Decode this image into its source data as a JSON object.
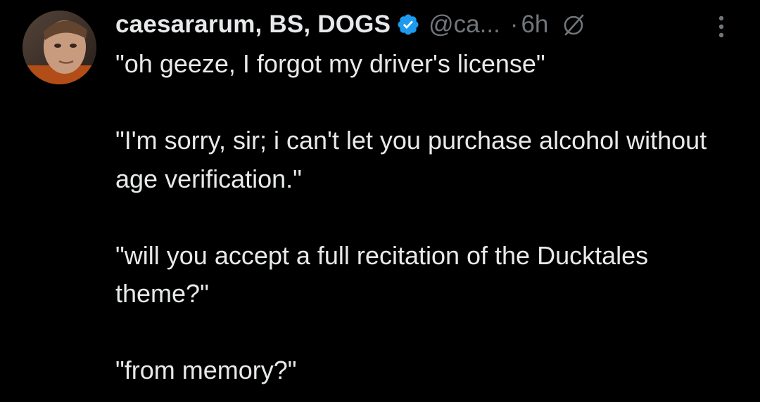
{
  "author": {
    "display_name": "caesararum, BS, DOGS",
    "handle": "@ca...",
    "verified": true,
    "avatar_icon": "profile-photo"
  },
  "meta": {
    "separator": "·",
    "timestamp": "6h",
    "muted_icon": "muted-circle-slash-icon",
    "more_icon": "vertical-ellipsis-icon"
  },
  "tweet": {
    "paragraphs": [
      "\"oh geeze, I forgot my driver's license\"",
      "\"I'm sorry, sir; i can't let you purchase alcohol without age verification.\"",
      "\"will you accept a full recitation of the Ducktales theme?\"",
      "\"from memory?\""
    ]
  },
  "colors": {
    "background": "#000000",
    "text": "#e7e9ea",
    "secondary": "#71767b",
    "verified_blue": "#1d9bf0"
  }
}
